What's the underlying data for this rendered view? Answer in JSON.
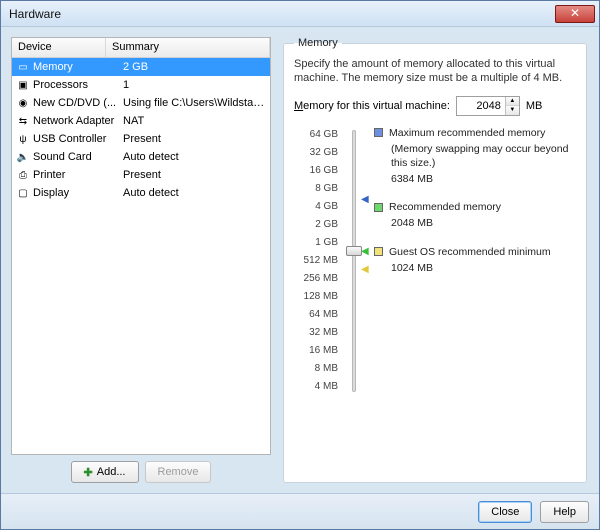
{
  "window": {
    "title": "Hardware"
  },
  "device_list": {
    "headers": {
      "device": "Device",
      "summary": "Summary"
    },
    "selected_index": 0,
    "rows": [
      {
        "icon": "memory-icon",
        "name": "Memory",
        "summary": "2 GB"
      },
      {
        "icon": "cpu-icon",
        "name": "Processors",
        "summary": "1"
      },
      {
        "icon": "disc-icon",
        "name": "New CD/DVD (...",
        "summary": "Using file C:\\Users\\Wildstar\\Downl..."
      },
      {
        "icon": "network-icon",
        "name": "Network Adapter",
        "summary": "NAT"
      },
      {
        "icon": "usb-icon",
        "name": "USB Controller",
        "summary": "Present"
      },
      {
        "icon": "sound-icon",
        "name": "Sound Card",
        "summary": "Auto detect"
      },
      {
        "icon": "printer-icon",
        "name": "Printer",
        "summary": "Present"
      },
      {
        "icon": "display-icon",
        "name": "Display",
        "summary": "Auto detect"
      }
    ],
    "buttons": {
      "add": "Add...",
      "remove": "Remove"
    }
  },
  "memory_panel": {
    "group_title": "Memory",
    "description": "Specify the amount of memory allocated to this virtual machine. The memory size must be a multiple of 4 MB.",
    "field_label": "Memory for this virtual machine:",
    "value": "2048",
    "unit": "MB",
    "ticks": [
      "64 GB",
      "32 GB",
      "16 GB",
      "8 GB",
      "4 GB",
      "2 GB",
      "1 GB",
      "512 MB",
      "256 MB",
      "128 MB",
      "64 MB",
      "32 MB",
      "16 MB",
      "8 MB",
      "4 MB"
    ],
    "markers": {
      "max": {
        "label": "Maximum recommended memory",
        "note": "(Memory swapping may occur beyond this size.)",
        "value": "6384 MB"
      },
      "rec": {
        "label": "Recommended memory",
        "value": "2048 MB"
      },
      "guest": {
        "label": "Guest OS recommended minimum",
        "value": "1024 MB"
      }
    }
  },
  "bottom": {
    "close": "Close",
    "help": "Help"
  }
}
